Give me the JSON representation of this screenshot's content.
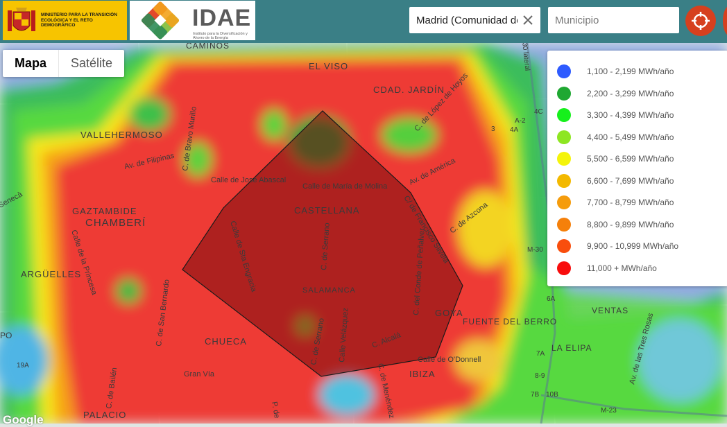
{
  "header": {
    "ministry_text": "MINISTERIO PARA LA TRANSICIÓN ECOLÓGICA Y EL RETO DEMOGRÁFICO",
    "idae_word": "IDAE",
    "idae_sub": "Instituto para la Diversificación y Ahorro de la Energía"
  },
  "filters": {
    "region_value": "Madrid (Comunidad de",
    "municipio_placeholder": "Municipio"
  },
  "map_type": {
    "map_label": "Mapa",
    "satellite_label": "Satélite",
    "selected": "Mapa"
  },
  "legend": {
    "items": [
      {
        "label": "1,100 - 2,199 MWh/año",
        "color": "#2e5bff"
      },
      {
        "label": "2,200 - 3,299 MWh/año",
        "color": "#1fa832"
      },
      {
        "label": "3,300 - 4,399 MWh/año",
        "color": "#16f01c"
      },
      {
        "label": "4,400 - 5,499 MWh/año",
        "color": "#8ee622"
      },
      {
        "label": "5,500 - 6,599 MWh/año",
        "color": "#f4f40a"
      },
      {
        "label": "6,600 - 7,699 MWh/año",
        "color": "#f3b900"
      },
      {
        "label": "7,700 - 8,799 MWh/año",
        "color": "#f59c0c"
      },
      {
        "label": "8,800 - 9,899 MWh/año",
        "color": "#f5800a"
      },
      {
        "label": "9,900 - 10,999 MWh/año",
        "color": "#f94e0d"
      },
      {
        "label": "11,000 + MWh/año",
        "color": "#f80d0d"
      }
    ]
  },
  "map_labels": {
    "caminos": "CAMINOS",
    "el_viso": "EL VISO",
    "cdad_jardin": "CDAD. JARDÍN",
    "vallehermoso": "VALLEHERMOSO",
    "gaztambide": "GAZTAMBIDE",
    "chamberi": "CHAMBERÍ",
    "castellana": "CASTELLANA",
    "arguelles": "ARGÜELLES",
    "salamanca": "SALAMANCA",
    "goya": "GOYA",
    "fuente_del_berro": "FUENTE DEL BERRO",
    "ventas": "VENTAS",
    "chueca": "CHUECA",
    "la_elipa": "LA ELIPA",
    "ibiza": "IBIZA",
    "palacio": "PALACIO",
    "po": "PO",
    "calle_jose_abascal": "Calle de José Abascal",
    "calle_maria_molina": "Calle de María de Molina",
    "av_filipinas": "Av. de Filipinas",
    "c_bravo_murillo": "C. de Bravo Murillo",
    "c_lopez_hoyos": "C. de López de Hoyos",
    "av_america": "Av. de América",
    "c_francisco_silvela": "C/ de Francisco Silvela",
    "c_azcona": "C. de Azcona",
    "c_sta_engracia": "Calle de Sta Engracia",
    "c_serrano": "C. de Serrano",
    "c_conde_penalver": "C. del Conde de Peñalver",
    "calle_princesa": "Calle de la Princesa",
    "c_san_bernardo": "C. de San Bernardo",
    "calle_velazquez": "Calle Velázquez",
    "c_alcala": "C. Alcalá",
    "calle_odonnell": "Calle de O'Donnell",
    "c_serrano_2": "C. de Serrano",
    "gran_via": "Gran Vía",
    "c_bailen": "C. de Bailén",
    "av_m_30": "M-30",
    "m30_lateral": "M-30 lateral",
    "m23": "M-23",
    "av_tres_rosas": "Av. de las Tres Rosas",
    "c_menendez": "C. de Menéndez",
    "a2": "A-2",
    "p_de": "P. de",
    "sen": "Senecà",
    "c_alcala_2": "Calle de Alcalá",
    "badge_4a": "4A",
    "badge_4c": "4C",
    "badge_7a": "7A",
    "badge_89": "8-9",
    "badge_7b": "7B",
    "badge_10b": "10B",
    "badge_19a": "19A",
    "badge_3": "3",
    "badge_6a": "6A"
  },
  "google_logo": "Google"
}
